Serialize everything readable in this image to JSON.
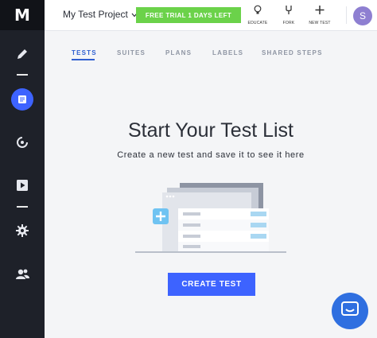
{
  "sidebar": {
    "logo": "M",
    "items": [
      {
        "icon": "pencil-icon"
      },
      {
        "icon": "test-list-icon",
        "active": true
      },
      {
        "icon": "runs-icon"
      },
      {
        "icon": "play-icon"
      },
      {
        "icon": "gear-icon"
      },
      {
        "icon": "team-icon"
      }
    ]
  },
  "header": {
    "project_name": "My Test Project",
    "trial_label": "FREE TRIAL 1 DAYS LEFT",
    "buttons": [
      {
        "label": "EDUCATE",
        "icon": "lightbulb-icon"
      },
      {
        "label": "FORK",
        "icon": "fork-icon"
      },
      {
        "label": "NEW TEST",
        "icon": "plus-icon"
      }
    ],
    "avatar_initial": "S"
  },
  "tabs": [
    {
      "label": "TESTS",
      "active": true
    },
    {
      "label": "SUITES"
    },
    {
      "label": "PLANS"
    },
    {
      "label": "LABELS"
    },
    {
      "label": "SHARED STEPS"
    }
  ],
  "main": {
    "title": "Start Your Test List",
    "subtitle": "Create a new test and save it to see it here",
    "create_button": "CREATE TEST"
  },
  "colors": {
    "accent": "#3d63ff",
    "trial": "#6bd24a",
    "sidebar": "#1e2129"
  }
}
